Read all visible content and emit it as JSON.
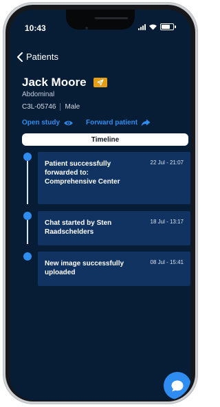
{
  "status_bar": {
    "time": "10:43"
  },
  "nav": {
    "back_label": "Patients"
  },
  "patient": {
    "name": "Jack Moore",
    "body_part": "Abdominal",
    "id": "C3L-05746",
    "sex": "Male"
  },
  "actions": {
    "open_study": "Open study",
    "forward_patient": "Forward patient"
  },
  "timeline_button": "Timeline",
  "timeline": [
    {
      "text": "Patient successfully forwarded to: Comprehensive Center",
      "time": "22 Jul - 21:07"
    },
    {
      "text": "Chat started by Sten Raadschelders",
      "time": "18 Jul - 13:17"
    },
    {
      "text": "New image successfully uploaded",
      "time": "08 Jul - 15:41"
    }
  ],
  "icons": {
    "back": "chevron-left-icon",
    "send": "send-icon",
    "eye": "eye-icon",
    "forward": "share-arrow-icon",
    "chat": "chat-bubble-icon"
  },
  "colors": {
    "screen_bg": "#071d36",
    "card_bg": "#113361",
    "accent": "#2f8cf0",
    "badge": "#e3a017"
  }
}
